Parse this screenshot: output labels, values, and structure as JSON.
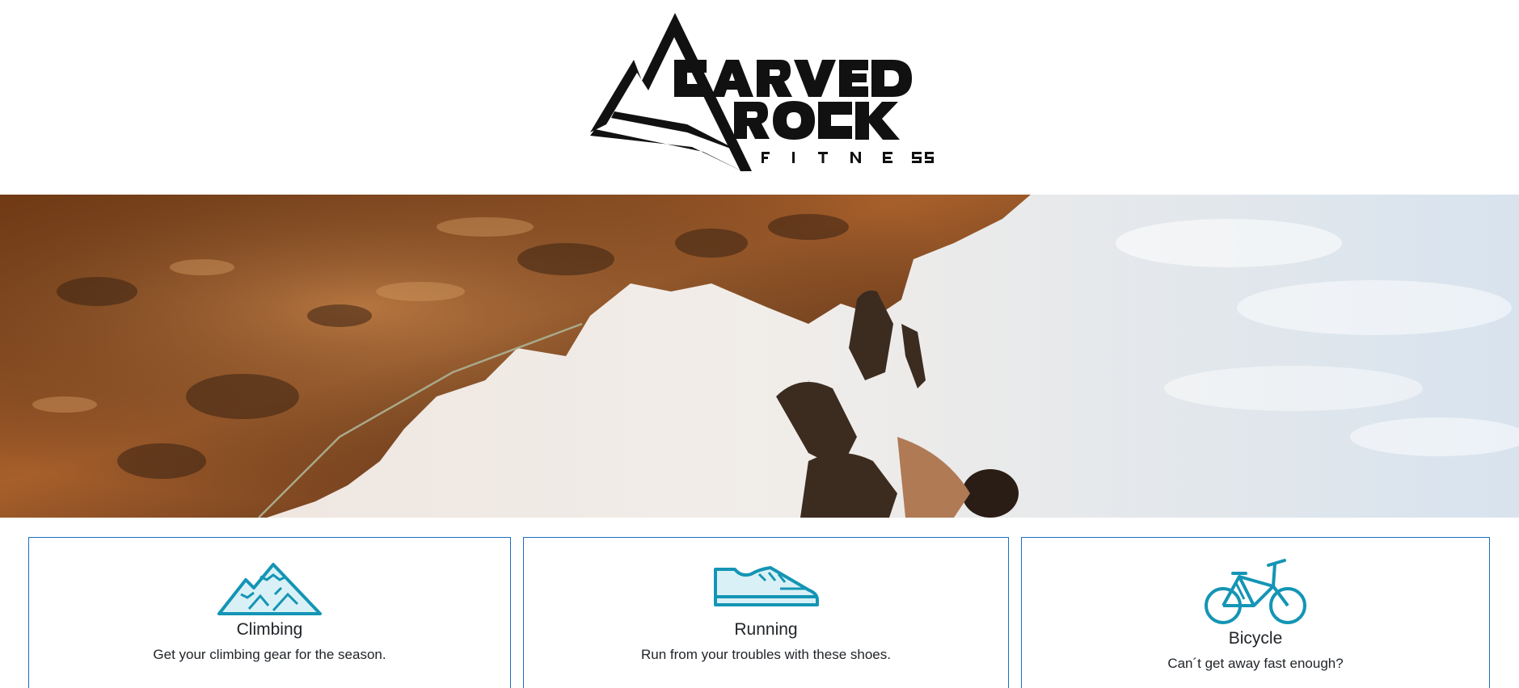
{
  "brand": {
    "logo_line1": "CARVED",
    "logo_line2": "ROCK",
    "logo_line3": "FITNESS"
  },
  "categories": [
    {
      "title": "Climbing",
      "description": "Get your climbing gear for the season.",
      "icon": "mountain-icon"
    },
    {
      "title": "Running",
      "description": "Run from your troubles with these shoes.",
      "icon": "shoe-icon"
    },
    {
      "title": "Bicycle",
      "description": "Can´t get away fast enough?",
      "icon": "bicycle-icon"
    }
  ],
  "colors": {
    "card_border": "#1a6fc4",
    "icon_stroke": "#1495b5",
    "icon_fill": "#d9f1f6",
    "logo": "#111111"
  }
}
